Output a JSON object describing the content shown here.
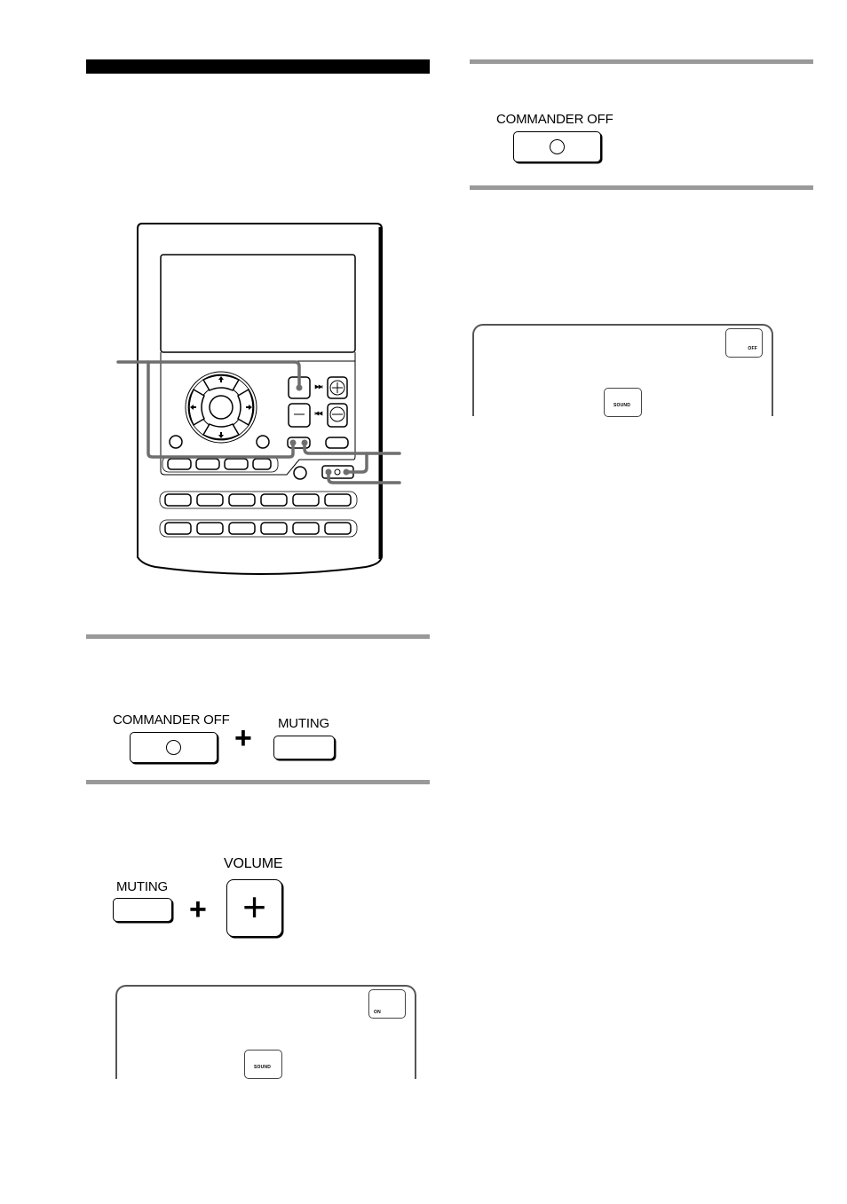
{
  "page": {
    "left_column": {
      "remote_figure": {
        "description": "Remote commander illustration with callout lines",
        "callouts": [
          "set-button",
          "muting-button-pair",
          "commander-off-button"
        ]
      },
      "step_combo_1": {
        "commander_off_label": "COMMANDER OFF",
        "plus": "+",
        "muting_label": "MUTING"
      },
      "step_combo_2": {
        "muting_label": "MUTING",
        "plus": "+",
        "volume_label": "VOLUME",
        "volume_glyph": "+"
      },
      "screen_preview": {
        "corner_button_label": "ON",
        "center_button_label": "SOUND"
      }
    },
    "right_column": {
      "step_single": {
        "commander_off_label": "COMMANDER OFF"
      },
      "screen_preview": {
        "corner_button_label": "OFF",
        "center_button_label": "SOUND"
      }
    }
  },
  "colors": {
    "rule": "#999999",
    "callout": "#6e6e6e",
    "ink": "#000000"
  }
}
